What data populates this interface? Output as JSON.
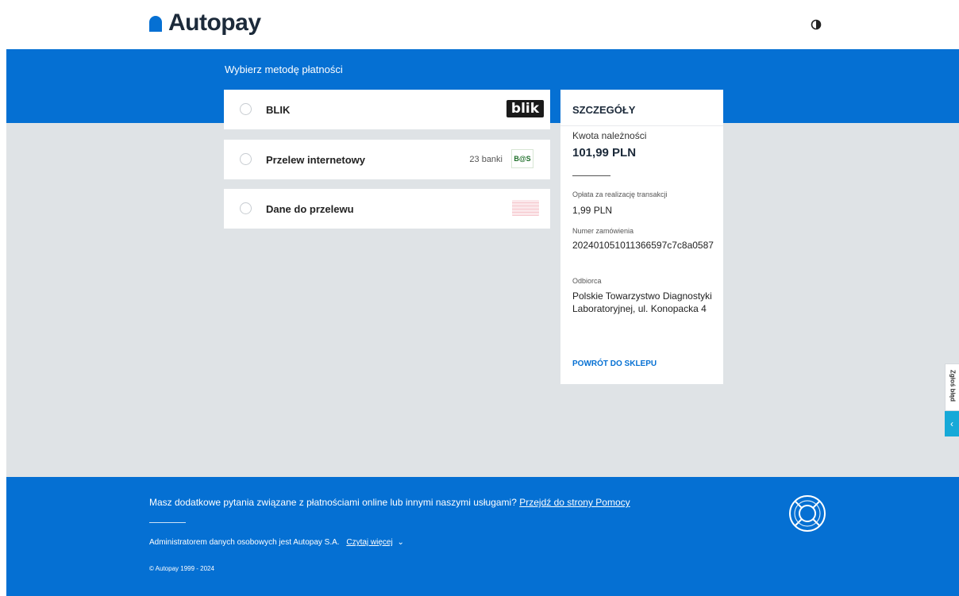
{
  "header": {
    "brand": "Autopay",
    "icons": {
      "logo": "autopay-logo-icon",
      "contrast": "contrast-toggle-icon"
    },
    "brand_color": "#0570d3"
  },
  "payment": {
    "section_title": "Wybierz metodę płatności",
    "methods": [
      {
        "label": "BLIK",
        "logo_text": "blik",
        "icon": "blik-logo-icon"
      },
      {
        "label": "Przelew internetowy",
        "bank_count": "23 banki",
        "logo_text": "B@S",
        "icon": "bos-bank-logo-icon"
      },
      {
        "label": "Dane do przelewu",
        "icon": "transfer-data-icon"
      }
    ]
  },
  "details": {
    "title": "SZCZEGÓŁY",
    "amount_label": "Kwota należności",
    "amount": "101,99 PLN",
    "fee_label": "Opłata za realizację transakcji",
    "fee": "1,99 PLN",
    "order_label": "Numer zamówienia",
    "order_number": "20240105101136​6597c7c8a0587",
    "recipient_label": "Odbiorca",
    "recipient": "Polskie Towarzystwo Diagnostyki Laboratoryjnej, ul. Konopacka 4",
    "back_link": "POWRÓT DO SKLEPU"
  },
  "side": {
    "report": "Zgłoś błąd",
    "arrow": "‹"
  },
  "footer": {
    "question": "Masz dodatkowe pytania związane z płatnościami online lub innymi naszymi usługami?",
    "help_link": "Przejdź do strony Pomocy",
    "admin": "Administratorem danych osobowych jest Autopay S.A.",
    "read_more": "Czytaj więcej",
    "chevron": "⌄",
    "copyright": "© Autopay 1999 - 2024",
    "icon": "lifebuoy-help-icon"
  },
  "colors": {
    "band": "#0570d3",
    "page_bg": "#dfe3e6",
    "accent_tab": "#16a9d8"
  }
}
